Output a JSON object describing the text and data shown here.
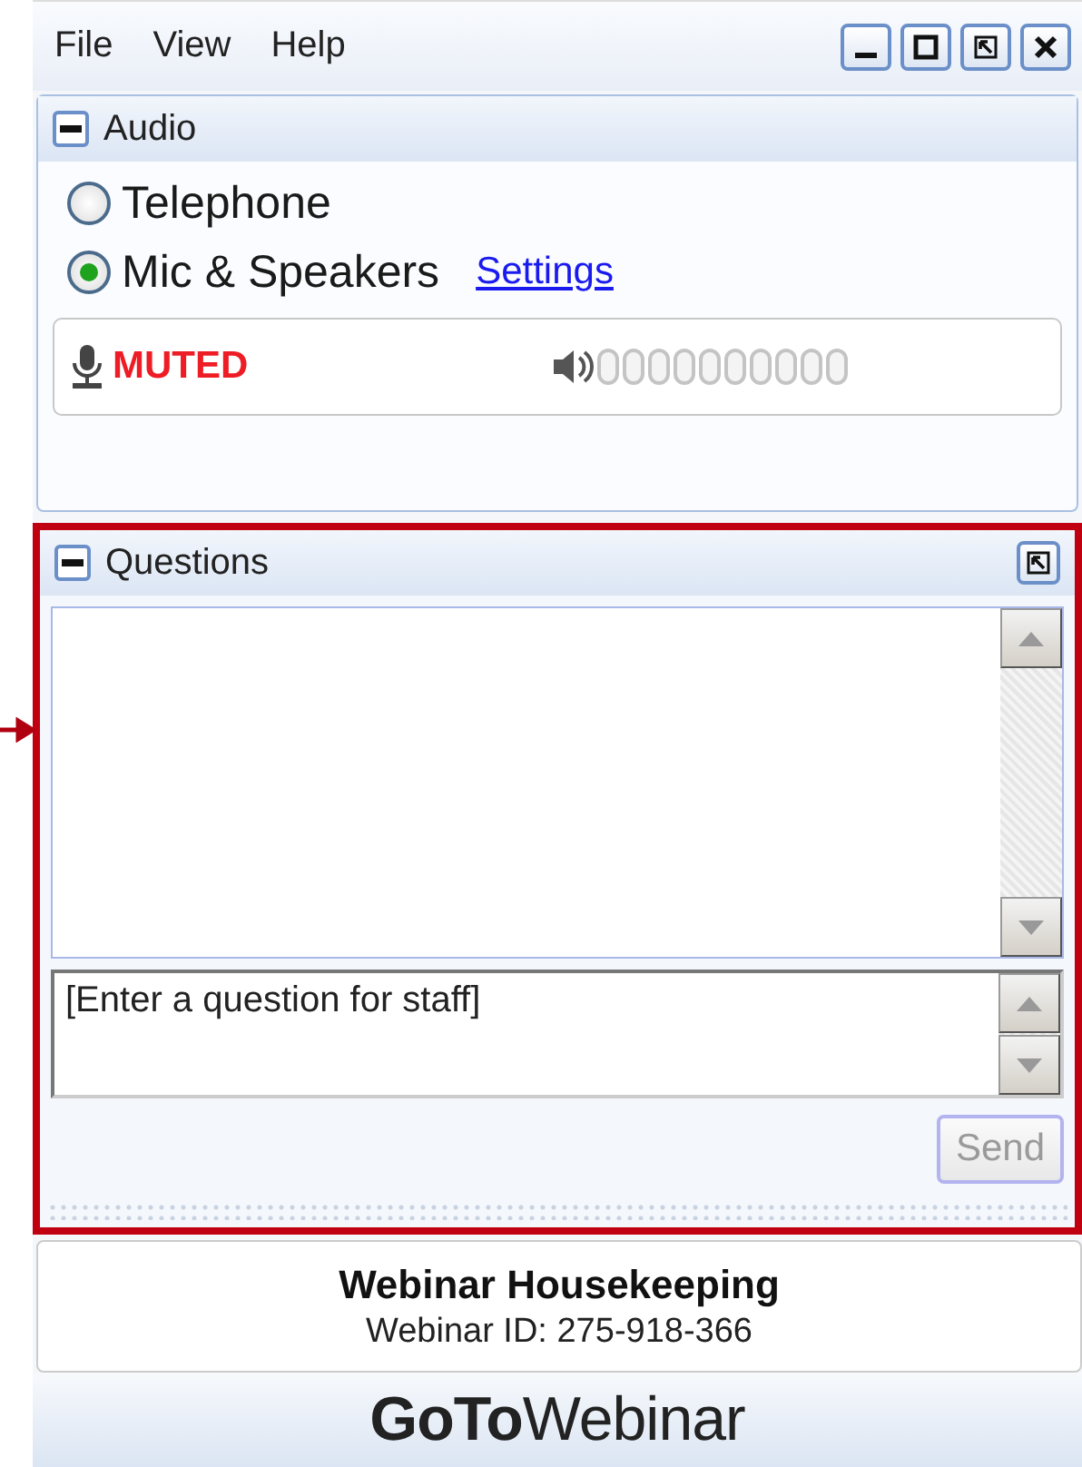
{
  "menu": [
    "File",
    "View",
    "Help"
  ],
  "audio": {
    "title": "Audio",
    "options": [
      {
        "label": "Telephone",
        "selected": false
      },
      {
        "label": "Mic & Speakers",
        "selected": true
      }
    ],
    "settings_link": "Settings",
    "mic_status": "MUTED"
  },
  "questions": {
    "title": "Questions",
    "placeholder": "[Enter a question for staff]",
    "send": {
      "label": "Send",
      "disabled": true
    }
  },
  "info": {
    "title": "Webinar Housekeeping",
    "id_line": "Webinar ID: 275-918-366"
  },
  "logo": "**GoTo**Webinar"
}
